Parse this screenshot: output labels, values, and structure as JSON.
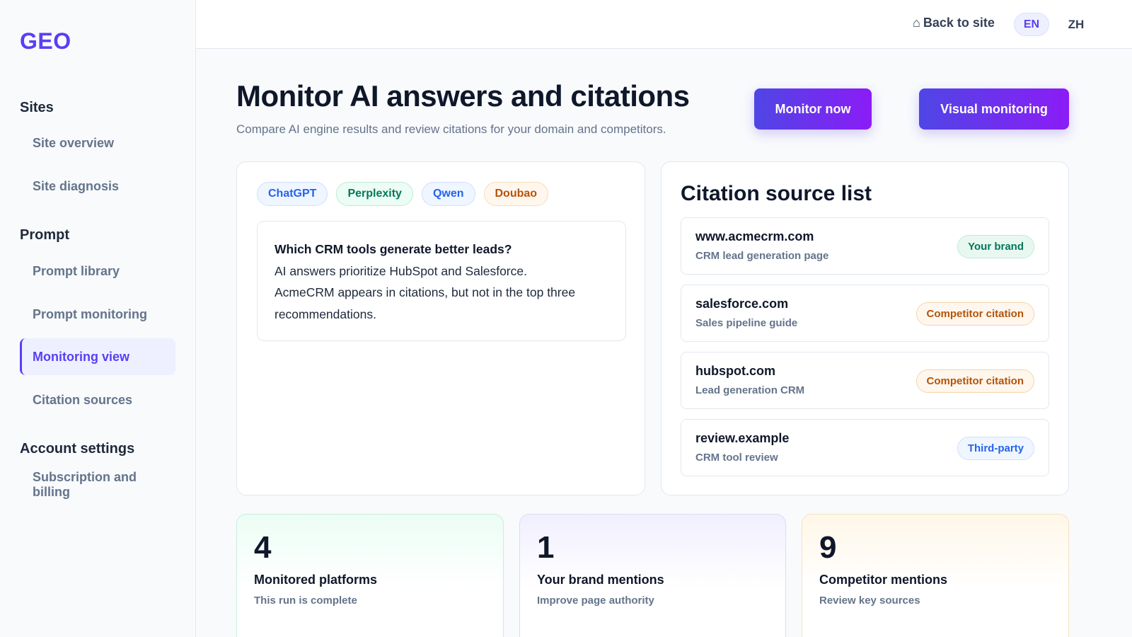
{
  "app": {
    "logo": "GEO"
  },
  "topbar": {
    "back_icon": "⌂",
    "back_label": "Back to site",
    "lang_en": "EN",
    "lang_zh": "ZH"
  },
  "sidebar": {
    "sections": [
      {
        "title": "Sites",
        "items": [
          "Site overview",
          "Site diagnosis"
        ]
      },
      {
        "title": "Prompt",
        "items": [
          "Prompt library",
          "Prompt monitoring",
          "Monitoring view",
          "Citation sources"
        ]
      },
      {
        "title": "Account settings",
        "items": [
          "Subscription and billing"
        ]
      }
    ],
    "active_item": "Monitoring view"
  },
  "header": {
    "title": "Monitor AI answers and citations",
    "subtitle": "Compare AI engine results and review citations for your domain and competitors.",
    "monitor_now": "Monitor now",
    "visual_monitoring": "Visual monitoring"
  },
  "engines": [
    "ChatGPT",
    "Perplexity",
    "Qwen",
    "Doubao"
  ],
  "answer": {
    "question": "Which CRM tools generate better leads?",
    "line1": "AI answers prioritize HubSpot and Salesforce.",
    "line2": "AcmeCRM appears in citations, but not in the top three",
    "line3": "recommendations."
  },
  "citations": {
    "title": "Citation source list",
    "rows": [
      {
        "domain": "www.acmecrm.com",
        "desc": "CRM lead generation page",
        "badge": "Your brand"
      },
      {
        "domain": "salesforce.com",
        "desc": "Sales pipeline guide",
        "badge": "Competitor citation"
      },
      {
        "domain": "hubspot.com",
        "desc": "Lead generation CRM",
        "badge": "Competitor citation"
      },
      {
        "domain": "review.example",
        "desc": "CRM tool review",
        "badge": "Third-party"
      }
    ]
  },
  "stats": [
    {
      "value": "4",
      "label": "Monitored platforms",
      "sub": "This run is complete"
    },
    {
      "value": "1",
      "label": "Your brand mentions",
      "sub": "Improve page authority"
    },
    {
      "value": "9",
      "label": "Competitor mentions",
      "sub": "Review key sources"
    }
  ],
  "colors": {
    "accent": "#5b3df5",
    "button_gradient_start": "#4f46e5",
    "button_gradient_end": "#8b1cf6"
  }
}
